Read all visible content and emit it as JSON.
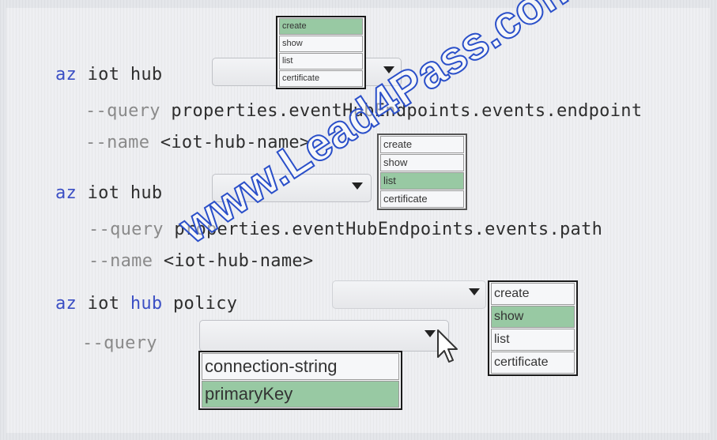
{
  "commands": {
    "cmd1": {
      "az": "az",
      "iot_hub": "iot hub"
    },
    "cmd1_query": {
      "flag": "--query",
      "value": "properties.eventHubEndpoints.events.endpoint"
    },
    "cmd1_name": {
      "flag": "--name",
      "value": "<iot-hub-name>"
    },
    "cmd2": {
      "az": "az",
      "iot_hub": "iot hub"
    },
    "cmd2_query": {
      "flag": "--query",
      "value": "properties.eventHubEndpoints.events.path"
    },
    "cmd2_name": {
      "flag": "--name",
      "value": "<iot-hub-name>"
    },
    "cmd3": {
      "az": "az",
      "iot": "iot",
      "hub": "hub",
      "policy": "policy"
    },
    "cmd3_query": {
      "flag": "--query"
    }
  },
  "dropdown1": {
    "options": [
      "create",
      "show",
      "list",
      "certificate"
    ],
    "selected": "create"
  },
  "dropdown2": {
    "options": [
      "create",
      "show",
      "list",
      "certificate"
    ],
    "selected": "list"
  },
  "dropdown3": {
    "options": [
      "create",
      "show",
      "list",
      "certificate"
    ],
    "selected": "show"
  },
  "dropdown4": {
    "options": [
      "connection-string",
      "primaryKey"
    ],
    "selected": "primaryKey"
  },
  "watermark": "www.Lead4Pass.com",
  "colors": {
    "selected_option": "#98c9a3",
    "keyword": "#3b4fc4",
    "watermark_stroke": "#2a4fc9"
  }
}
